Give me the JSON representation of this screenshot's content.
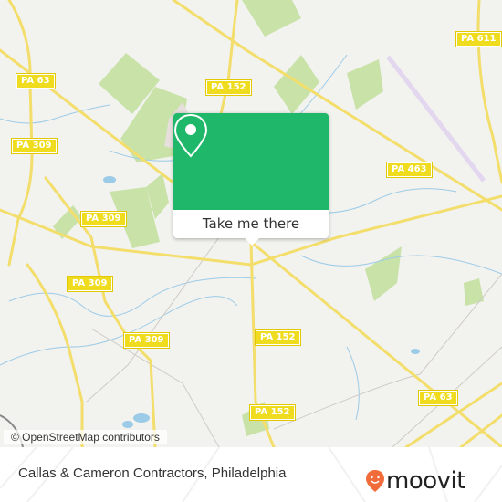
{
  "map": {
    "road_shields": [
      {
        "label": "PA 611"
      },
      {
        "label": "PA 63"
      },
      {
        "label": "PA 152"
      },
      {
        "label": "PA 309"
      },
      {
        "label": "PA 463"
      },
      {
        "label": "PA 309"
      },
      {
        "label": "PA 309"
      },
      {
        "label": "PA 152"
      },
      {
        "label": "PA 309"
      },
      {
        "label": "PA 63"
      },
      {
        "label": "PA 152"
      }
    ],
    "attribution": "© OpenStreetMap contributors"
  },
  "popup": {
    "icon": "location-pin-icon",
    "button_label": "Take me there",
    "accent_color": "#1fb86a"
  },
  "footer": {
    "place_title": "Callas & Cameron Contractors, Philadelphia",
    "logo_text": "moovit",
    "logo_icon": "moovit-smiley-pin-icon",
    "logo_color": "#f26b3a"
  }
}
